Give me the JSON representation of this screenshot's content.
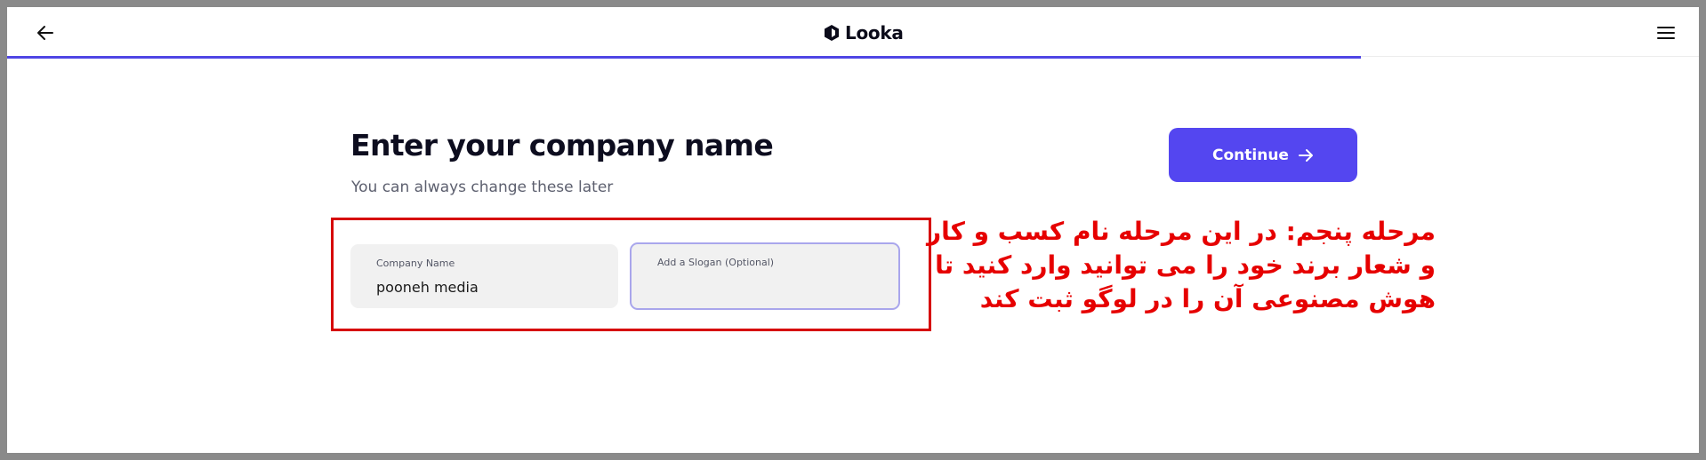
{
  "header": {
    "brand_name": "Looka",
    "back_icon": "arrow-left-icon",
    "menu_icon": "hamburger-menu-icon",
    "brand_icon": "looka-logo-icon"
  },
  "progress": {
    "fraction": 0.8,
    "color": "#4f46e5"
  },
  "main": {
    "title": "Enter your company name",
    "subtitle": "You can always change these later",
    "continue_label": "Continue",
    "continue_icon": "arrow-right-icon",
    "continue_color": "#5446f0"
  },
  "fields": {
    "company_name_label": "Company Name",
    "company_name_value": "pooneh media",
    "slogan_label": "Add a Slogan (Optional)",
    "slogan_value": ""
  },
  "annotation": {
    "color": "#e60000",
    "lines": [
      "مرحله پنجم: در این مرحله نام کسب و کار",
      "و شعار برند خود را می توانید وارد کنید تا",
      "هوش مصنوعی آن را در لوگو ثبت کند"
    ]
  }
}
